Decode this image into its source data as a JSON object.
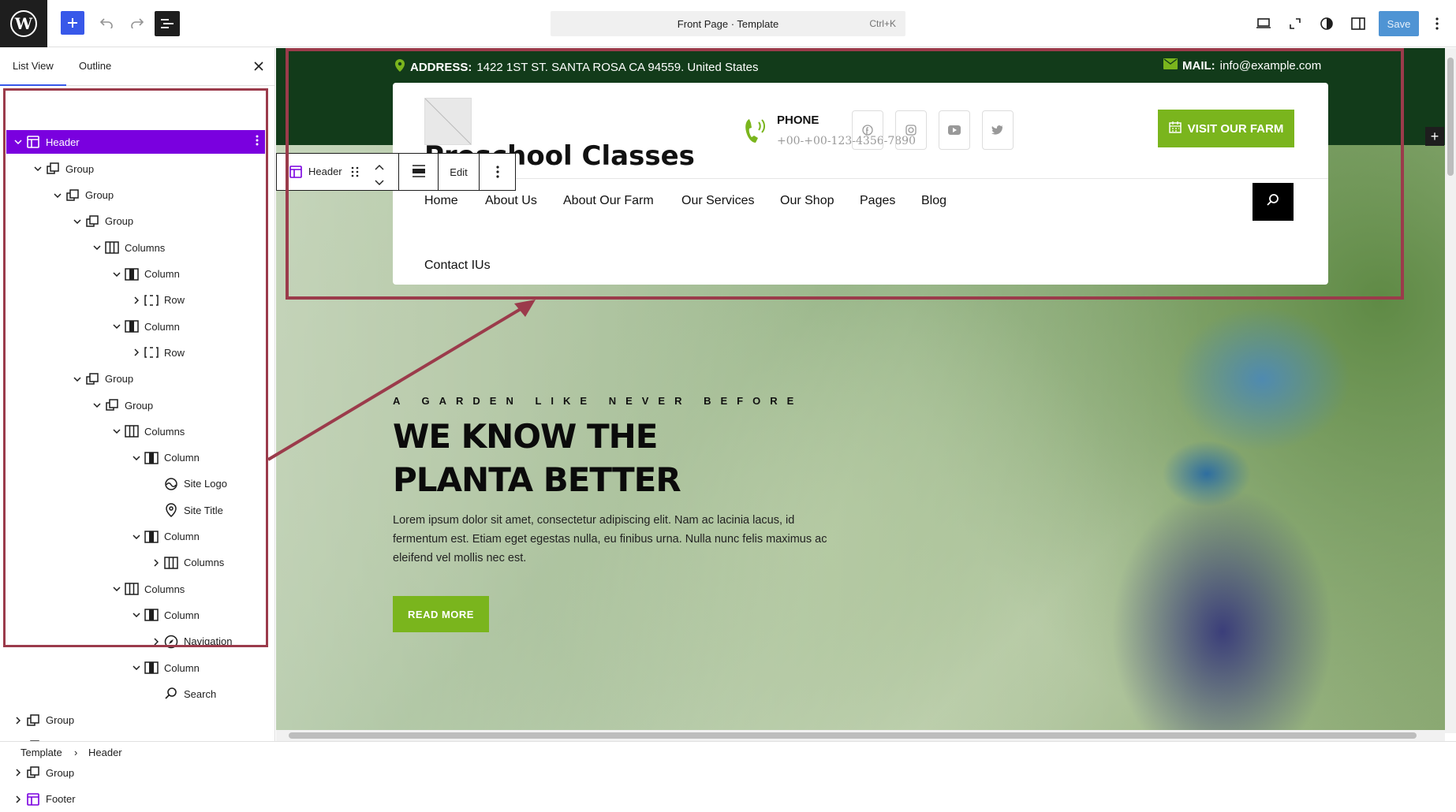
{
  "topbar": {
    "command_label": "Front Page · Template",
    "command_shortcut": "Ctrl+K",
    "save_label": "Save"
  },
  "sidebar": {
    "tab_list_view": "List View",
    "tab_outline": "Outline",
    "tree": [
      {
        "label": "Header",
        "depth": 0,
        "icon": "template-part-icon",
        "chevron": "down",
        "selected": true
      },
      {
        "label": "Group",
        "depth": 1,
        "icon": "group-icon",
        "chevron": "down"
      },
      {
        "label": "Group",
        "depth": 2,
        "icon": "group-icon",
        "chevron": "down"
      },
      {
        "label": "Group",
        "depth": 3,
        "icon": "group-icon",
        "chevron": "down"
      },
      {
        "label": "Columns",
        "depth": 4,
        "icon": "columns-icon",
        "chevron": "down"
      },
      {
        "label": "Column",
        "depth": 5,
        "icon": "column-icon",
        "chevron": "down"
      },
      {
        "label": "Row",
        "depth": 6,
        "icon": "row-icon",
        "chevron": "right"
      },
      {
        "label": "Column",
        "depth": 5,
        "icon": "column-icon",
        "chevron": "down"
      },
      {
        "label": "Row",
        "depth": 6,
        "icon": "row-icon",
        "chevron": "right"
      },
      {
        "label": "Group",
        "depth": 3,
        "icon": "group-icon",
        "chevron": "down"
      },
      {
        "label": "Group",
        "depth": 4,
        "icon": "group-icon",
        "chevron": "down"
      },
      {
        "label": "Columns",
        "depth": 5,
        "icon": "columns-icon",
        "chevron": "down"
      },
      {
        "label": "Column",
        "depth": 6,
        "icon": "column-icon",
        "chevron": "down"
      },
      {
        "label": "Site Logo",
        "depth": 7,
        "icon": "site-logo-icon",
        "chevron": ""
      },
      {
        "label": "Site Title",
        "depth": 7,
        "icon": "site-title-icon",
        "chevron": ""
      },
      {
        "label": "Column",
        "depth": 6,
        "icon": "column-icon",
        "chevron": "down"
      },
      {
        "label": "Columns",
        "depth": 7,
        "icon": "columns-icon",
        "chevron": "right"
      },
      {
        "label": "Columns",
        "depth": 5,
        "icon": "columns-icon",
        "chevron": "down"
      },
      {
        "label": "Column",
        "depth": 6,
        "icon": "column-icon",
        "chevron": "down"
      },
      {
        "label": "Navigation",
        "depth": 7,
        "icon": "navigation-icon",
        "chevron": "right"
      },
      {
        "label": "Column",
        "depth": 6,
        "icon": "column-icon",
        "chevron": "down"
      },
      {
        "label": "Search",
        "depth": 7,
        "icon": "search-icon",
        "chevron": ""
      },
      {
        "label": "Group",
        "depth": 0,
        "icon": "group-icon",
        "chevron": "right"
      },
      {
        "label": "Group",
        "depth": 0,
        "icon": "group-icon",
        "chevron": "right"
      },
      {
        "label": "Group",
        "depth": 0,
        "icon": "group-icon",
        "chevron": "right"
      },
      {
        "label": "Footer",
        "depth": 0,
        "icon": "template-part-icon",
        "chevron": "right"
      }
    ]
  },
  "breadcrumb": {
    "item1": "Template",
    "item2": "Header"
  },
  "block_toolbar": {
    "block_label": "Header",
    "edit_label": "Edit"
  },
  "site": {
    "address_label": "ADDRESS:",
    "address_value": " 1422 1ST ST. SANTA ROSA CA 94559. United States",
    "mail_label": "MAIL:",
    "mail_value": " info@example.com",
    "title": "Preschool Classes",
    "phone_label": "PHONE",
    "phone_number": "+00-+00-123-4356-7890",
    "visit_label": "VISIT OUR FARM",
    "nav": [
      "Home",
      "About Us",
      "About Our Farm",
      "Our Services",
      "Our Shop",
      "Pages",
      "Blog"
    ],
    "nav_extra": "Contact IUs",
    "socials": [
      "facebook-icon",
      "instagram-icon",
      "youtube-icon",
      "twitter-icon"
    ]
  },
  "hero": {
    "tagline": "A GARDEN LIKE NEVER BEFORE",
    "headline": "WE KNOW THE PLANTA BETTER",
    "paragraph": "Lorem ipsum dolor sit amet, consectetur adipiscing elit. Nam ac lacinia lacus, id fermentum est. Etiam eget egestas nulla, eu finibus urna. Nulla nunc felis maximus ac eleifend vel mollis nec est.",
    "button": "READ MORE"
  },
  "colors": {
    "accent": "#7ab51d",
    "selected": "#7a00df",
    "wp_blue": "#3858e9",
    "dark_green": "#123b1a",
    "annotation_red": "#9b3b4b"
  }
}
